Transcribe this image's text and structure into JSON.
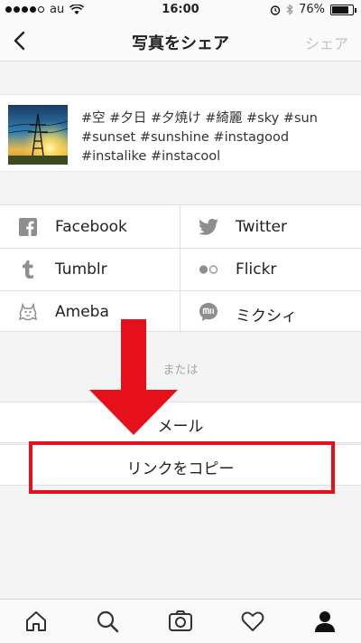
{
  "status_bar": {
    "carrier": "au",
    "time": "16:00",
    "battery_percent_label": "76%",
    "battery_level": 0.76
  },
  "nav": {
    "title": "写真をシェア",
    "share_label": "シェア"
  },
  "post": {
    "caption": "#空 #夕日 #夕焼け #綺麗 #sky #sun #sunset #sunshine #instagood #instalike #instacool"
  },
  "share_services": [
    {
      "label": "Facebook",
      "icon": "facebook-icon"
    },
    {
      "label": "Twitter",
      "icon": "twitter-icon"
    },
    {
      "label": "Tumblr",
      "icon": "tumblr-icon"
    },
    {
      "label": "Flickr",
      "icon": "flickr-icon"
    },
    {
      "label": "Ameba",
      "icon": "ameba-icon"
    },
    {
      "label": "ミクシィ",
      "icon": "mixi-icon"
    }
  ],
  "or_label": "または",
  "options": {
    "mail": "メール",
    "copy_link": "リンクをコピー"
  },
  "annotation": {
    "arrow_color": "#e5101a",
    "box_color": "#e5101a"
  },
  "tabs": [
    "home-icon",
    "search-icon",
    "camera-icon",
    "heart-icon",
    "profile-icon"
  ]
}
